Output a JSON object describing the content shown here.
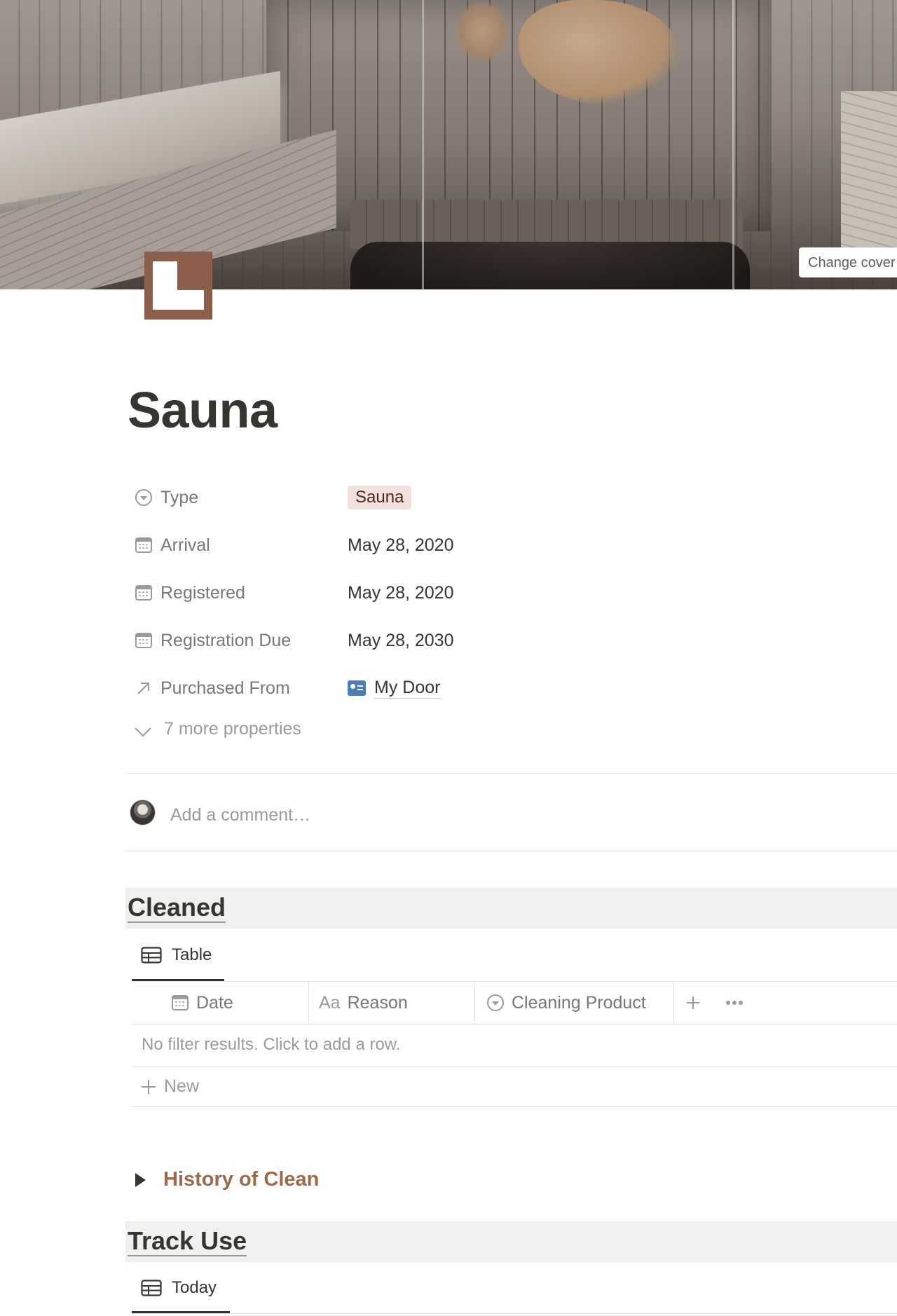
{
  "cover": {
    "change_cover_label": "Change cover"
  },
  "page": {
    "title": "Sauna",
    "icon": "sauna-page-icon"
  },
  "properties": [
    {
      "icon": "select-icon",
      "label": "Type",
      "value": "Sauna",
      "kind": "tag"
    },
    {
      "icon": "calendar-icon",
      "label": "Arrival",
      "value": "May 28, 2020",
      "kind": "date"
    },
    {
      "icon": "calendar-icon",
      "label": "Registered",
      "value": "May 28, 2020",
      "kind": "date"
    },
    {
      "icon": "calendar-icon",
      "label": "Registration Due",
      "value": "May 28, 2030",
      "kind": "date"
    },
    {
      "icon": "relation-arrow-icon",
      "label": "Purchased From",
      "value": "My Door",
      "kind": "relation",
      "value_icon": "contact-card-icon"
    }
  ],
  "more_properties": "7 more properties",
  "comment": {
    "placeholder": "Add a comment…"
  },
  "sections": {
    "cleaned": {
      "heading": "Cleaned",
      "view_label": "Table",
      "columns": [
        {
          "icon": "calendar-icon",
          "label": "Date"
        },
        {
          "icon": "text-icon",
          "label": "Reason"
        },
        {
          "icon": "select-icon",
          "label": "Cleaning Product"
        }
      ],
      "empty_message": "No filter results. Click to add a row.",
      "new_label": "New"
    },
    "history_toggle": "History of Clean",
    "track_use": {
      "heading": "Track Use",
      "view_label": "Today"
    }
  },
  "colors": {
    "accent_brown": "#9a6a4f",
    "tag_bg": "#f1e0db",
    "icon_brown": "#8b5f4a"
  }
}
